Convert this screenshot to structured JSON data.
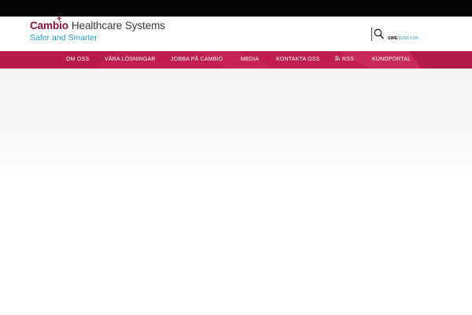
{
  "logo": {
    "cambio": "Cambio",
    "plus": "+",
    "rest": "Healthcare Systems",
    "tagline": "Safer and Smarter"
  },
  "languages": {
    "swe": "SWE",
    "separator": "|",
    "eng": "ENG",
    "dk": "DK"
  },
  "icons": {
    "search": "search-icon",
    "rss": "rss-icon"
  },
  "nav": {
    "items": [
      {
        "label": "OM OSS"
      },
      {
        "label": "VÅRA LÖSNINGAR"
      },
      {
        "label": "JOBBA PÅ CAMBIO"
      },
      {
        "label": "MEDIA"
      },
      {
        "label": "KONTAKTA OSS"
      },
      {
        "label": "RSS"
      },
      {
        "label": "KUNDPORTAL"
      }
    ]
  },
  "colors": {
    "topbar": "#050505",
    "nav": "#c21d51",
    "brand": "#8a1240",
    "tagline": "#1ea0c8"
  }
}
